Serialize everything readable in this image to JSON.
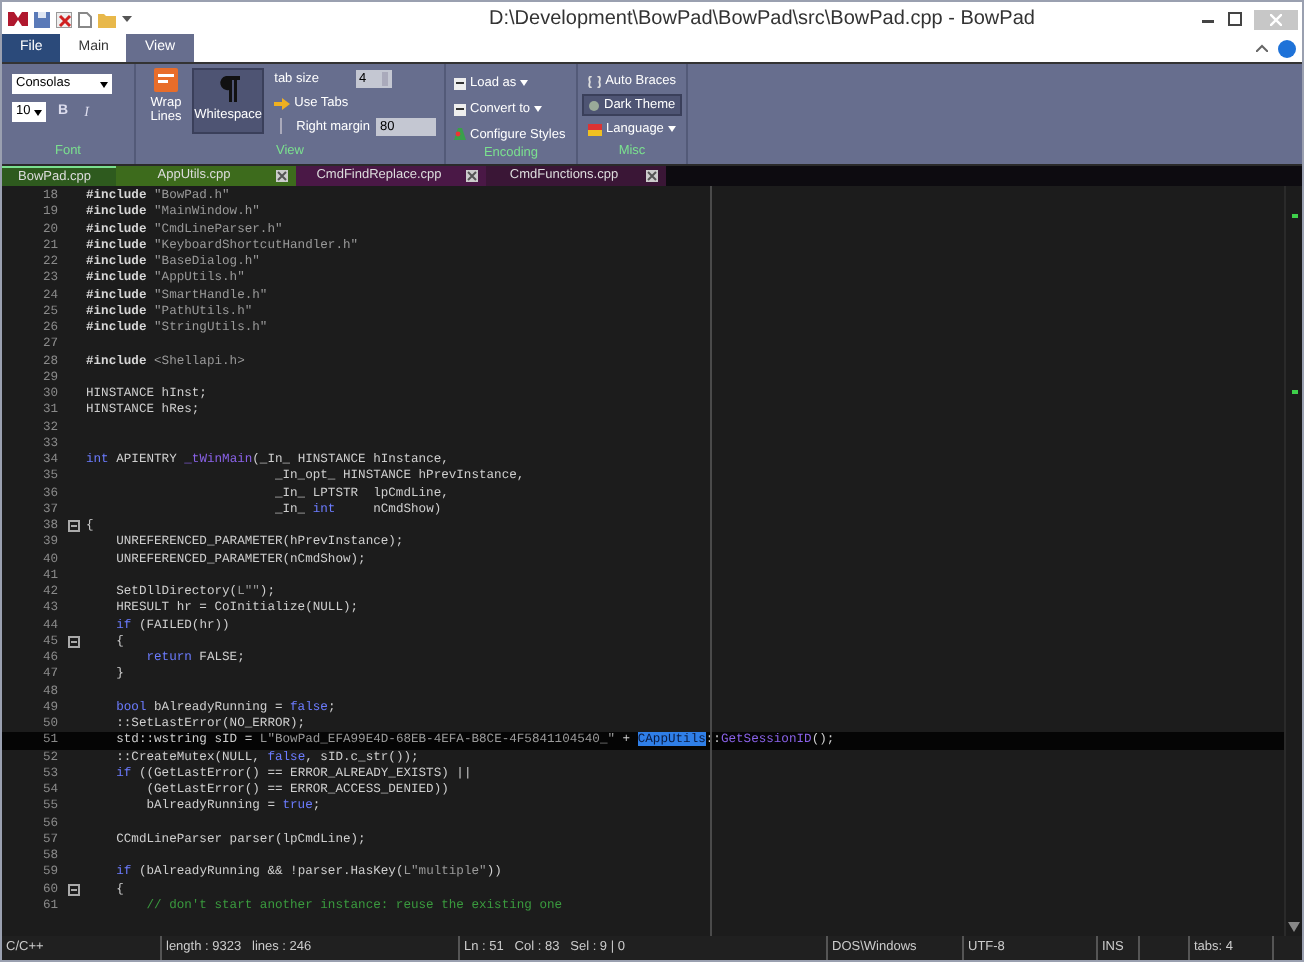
{
  "window": {
    "title": "D:\\Development\\BowPad\\BowPad\\src\\BowPad.cpp - BowPad"
  },
  "ribbon_tabs": [
    {
      "label": "File",
      "kind": "file",
      "selected": false
    },
    {
      "label": "Main",
      "kind": "tab",
      "selected": false
    },
    {
      "label": "View",
      "kind": "tab",
      "selected": true
    }
  ],
  "ribbon": {
    "font": {
      "family": "Consolas",
      "size": "10",
      "bold": "B",
      "italic": "I",
      "group": "Font"
    },
    "view": {
      "wrap_lines": "Wrap Lines",
      "whitespace": {
        "label": "Whitespace",
        "on": true
      },
      "tab_size_label": "tab size",
      "tab_size": "4",
      "use_tabs": "Use Tabs",
      "right_margin": {
        "label": "Right margin",
        "value": "80",
        "on": false
      },
      "group": "View"
    },
    "encoding": {
      "items": [
        "Load as",
        "Convert to",
        "Configure Styles"
      ],
      "group": "Encoding"
    },
    "misc": {
      "items": [
        {
          "label": "Auto Braces",
          "on": false,
          "dropdown": false
        },
        {
          "label": "Dark Theme",
          "on": true,
          "dropdown": false
        },
        {
          "label": "Language",
          "on": false,
          "dropdown": true
        }
      ],
      "group": "Misc"
    }
  },
  "doc_tabs": [
    {
      "label": "BowPad.cpp",
      "selected": true,
      "color": "#2e5a1e"
    },
    {
      "label": "AppUtils.cpp",
      "selected": false,
      "color": "#3d6b1c"
    },
    {
      "label": "CmdFindReplace.cpp",
      "selected": false,
      "color": "#4a1846"
    },
    {
      "label": "CmdFunctions.cpp",
      "selected": false,
      "color": "#3a1636"
    }
  ],
  "editor": {
    "lines": [
      {
        "number": "18",
        "segments": [
          {
            "kind": "pp",
            "text": "#include"
          },
          {
            "kind": "str",
            "text": " \"BowPad.h\""
          }
        ]
      },
      {
        "number": "19",
        "segments": [
          {
            "kind": "pp",
            "text": "#include"
          },
          {
            "kind": "str",
            "text": " \"MainWindow.h\""
          }
        ]
      },
      {
        "number": "20",
        "segments": [
          {
            "kind": "pp",
            "text": "#include"
          },
          {
            "kind": "str",
            "text": " \"CmdLineParser.h\""
          }
        ]
      },
      {
        "number": "21",
        "segments": [
          {
            "kind": "pp",
            "text": "#include"
          },
          {
            "kind": "str",
            "text": " \"KeyboardShortcutHandler.h\""
          }
        ]
      },
      {
        "number": "22",
        "segments": [
          {
            "kind": "pp",
            "text": "#include"
          },
          {
            "kind": "str",
            "text": " \"BaseDialog.h\""
          }
        ]
      },
      {
        "number": "23",
        "segments": [
          {
            "kind": "pp",
            "text": "#include"
          },
          {
            "kind": "str",
            "text": " \"AppUtils.h\""
          }
        ]
      },
      {
        "number": "24",
        "segments": [
          {
            "kind": "pp",
            "text": "#include"
          },
          {
            "kind": "str",
            "text": " \"SmartHandle.h\""
          }
        ]
      },
      {
        "number": "25",
        "segments": [
          {
            "kind": "pp",
            "text": "#include"
          },
          {
            "kind": "str",
            "text": " \"PathUtils.h\""
          }
        ]
      },
      {
        "number": "26",
        "segments": [
          {
            "kind": "pp",
            "text": "#include"
          },
          {
            "kind": "str",
            "text": " \"StringUtils.h\""
          }
        ]
      },
      {
        "number": "27"
      },
      {
        "number": "28",
        "segments": [
          {
            "kind": "pp",
            "text": "#include"
          },
          {
            "kind": "str",
            "text": " <Shellapi.h>"
          }
        ]
      },
      {
        "number": "29"
      },
      {
        "number": "30",
        "segments": [
          {
            "kind": "p",
            "text": "HINSTANCE hInst;"
          }
        ]
      },
      {
        "number": "31",
        "segments": [
          {
            "kind": "p",
            "text": "HINSTANCE hRes;"
          }
        ]
      },
      {
        "number": "32"
      },
      {
        "number": "33"
      },
      {
        "number": "34",
        "segments": [
          {
            "kind": "kw",
            "text": "int"
          },
          {
            "kind": "p",
            "text": " APIENTRY "
          },
          {
            "kind": "fn",
            "text": "_tWinMain"
          },
          {
            "kind": "p",
            "text": "(_In_ HINSTANCE hInstance,"
          }
        ]
      },
      {
        "number": "35",
        "segments": [
          {
            "kind": "p",
            "text": "                         _In_opt_ HINSTANCE hPrevInstance,"
          }
        ]
      },
      {
        "number": "36",
        "segments": [
          {
            "kind": "p",
            "text": "                         _In_ LPTSTR  lpCmdLine,"
          }
        ]
      },
      {
        "number": "37",
        "segments": [
          {
            "kind": "p",
            "text": "                         _In_ "
          },
          {
            "kind": "kw",
            "text": "int"
          },
          {
            "kind": "p",
            "text": "     nCmdShow)"
          }
        ]
      },
      {
        "number": "38",
        "fold": true,
        "segments": [
          {
            "kind": "p",
            "text": "{"
          }
        ]
      },
      {
        "number": "39",
        "segments": [
          {
            "kind": "p",
            "text": "    UNREFERENCED_PARAMETER(hPrevInstance);"
          }
        ]
      },
      {
        "number": "40",
        "segments": [
          {
            "kind": "p",
            "text": "    UNREFERENCED_PARAMETER(nCmdShow);"
          }
        ]
      },
      {
        "number": "41"
      },
      {
        "number": "42",
        "segments": [
          {
            "kind": "p",
            "text": "    SetDllDirectory("
          },
          {
            "kind": "str",
            "text": "L\"\""
          },
          {
            "kind": "p",
            "text": ");"
          }
        ]
      },
      {
        "number": "43",
        "segments": [
          {
            "kind": "p",
            "text": "    HRESULT hr = CoInitialize(NULL);"
          }
        ]
      },
      {
        "number": "44",
        "segments": [
          {
            "kind": "kw",
            "text": "    if"
          },
          {
            "kind": "p",
            "text": " (FAILED(hr))"
          }
        ]
      },
      {
        "number": "45",
        "fold": true,
        "segments": [
          {
            "kind": "p",
            "text": "    {"
          }
        ]
      },
      {
        "number": "46",
        "segments": [
          {
            "kind": "kw",
            "text": "        return"
          },
          {
            "kind": "p",
            "text": " FALSE;"
          }
        ]
      },
      {
        "number": "47",
        "segments": [
          {
            "kind": "p",
            "text": "    }"
          }
        ]
      },
      {
        "number": "48"
      },
      {
        "number": "49",
        "segments": [
          {
            "kind": "kw",
            "text": "    bool"
          },
          {
            "kind": "p",
            "text": " bAlreadyRunning = "
          },
          {
            "kind": "kw",
            "text": "false"
          },
          {
            "kind": "p",
            "text": ";"
          }
        ]
      },
      {
        "number": "50",
        "segments": [
          {
            "kind": "p",
            "text": "    ::SetLastError(NO_ERROR);"
          }
        ]
      },
      {
        "number": "51",
        "current": true,
        "segments": [
          {
            "kind": "p",
            "text": "    std::wstring sID = "
          },
          {
            "kind": "str",
            "text": "L\"BowPad_EFA99E4D-68EB-4EFA-B8CE-4F5841104540_\""
          },
          {
            "kind": "p",
            "text": " + "
          },
          {
            "kind": "sel",
            "text": "CAppUtils"
          },
          {
            "kind": "p",
            "text": "::"
          },
          {
            "kind": "fn",
            "text": "GetSessionID"
          },
          {
            "kind": "p",
            "text": "();"
          }
        ]
      },
      {
        "number": "52",
        "segments": [
          {
            "kind": "p",
            "text": "    ::CreateMutex(NULL, "
          },
          {
            "kind": "kw",
            "text": "false"
          },
          {
            "kind": "p",
            "text": ", sID.c_str());"
          }
        ]
      },
      {
        "number": "53",
        "segments": [
          {
            "kind": "kw",
            "text": "    if"
          },
          {
            "kind": "p",
            "text": " ((GetLastError() == ERROR_ALREADY_EXISTS) ||"
          }
        ]
      },
      {
        "number": "54",
        "segments": [
          {
            "kind": "p",
            "text": "        (GetLastError() == ERROR_ACCESS_DENIED))"
          }
        ]
      },
      {
        "number": "55",
        "segments": [
          {
            "kind": "p",
            "text": "        bAlreadyRunning = "
          },
          {
            "kind": "kw",
            "text": "true"
          },
          {
            "kind": "p",
            "text": ";"
          }
        ]
      },
      {
        "number": "56"
      },
      {
        "number": "57",
        "segments": [
          {
            "kind": "p",
            "text": "    CCmdLineParser parser(lpCmdLine);"
          }
        ]
      },
      {
        "number": "58"
      },
      {
        "number": "59",
        "segments": [
          {
            "kind": "kw",
            "text": "    if"
          },
          {
            "kind": "p",
            "text": " (bAlreadyRunning && !parser.HasKey("
          },
          {
            "kind": "str",
            "text": "L\"multiple\""
          },
          {
            "kind": "p",
            "text": "))"
          }
        ]
      },
      {
        "number": "60",
        "fold": true,
        "segments": [
          {
            "kind": "p",
            "text": "    {"
          }
        ]
      },
      {
        "number": "61",
        "segments": [
          {
            "kind": "comment",
            "text": "        // don't start another instance: reuse the existing one"
          }
        ]
      }
    ]
  },
  "status_bar": [
    "C/C++",
    "length : 9323   lines : 246",
    "Ln : 51   Col : 83   Sel : 9 | 0",
    "DOS\\Windows",
    "UTF-8",
    "INS",
    "tabs: 4"
  ]
}
